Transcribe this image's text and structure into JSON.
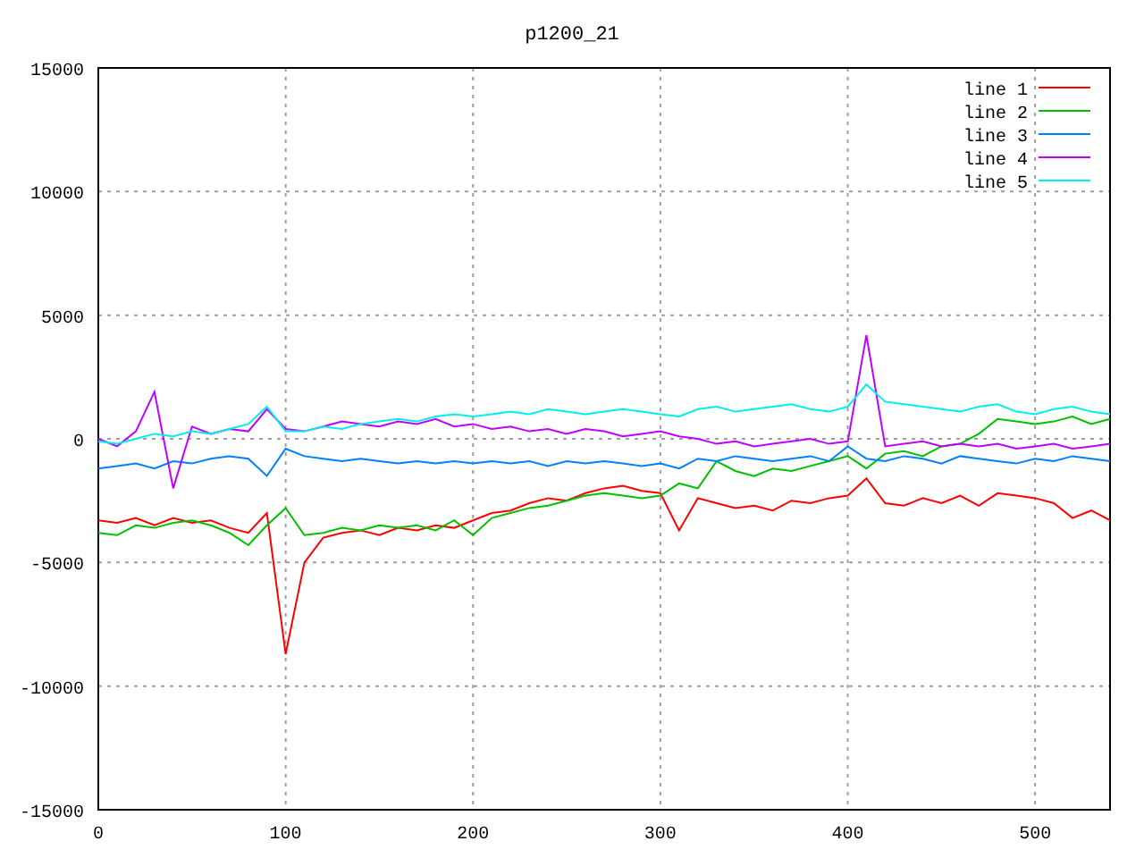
{
  "chart_data": {
    "type": "line",
    "title": "p1200_21",
    "x": [
      0,
      10,
      20,
      30,
      40,
      50,
      60,
      70,
      80,
      90,
      100,
      110,
      120,
      130,
      140,
      150,
      160,
      170,
      180,
      190,
      200,
      210,
      220,
      230,
      240,
      250,
      260,
      270,
      280,
      290,
      300,
      310,
      320,
      330,
      340,
      350,
      360,
      370,
      380,
      390,
      400,
      410,
      420,
      430,
      440,
      450,
      460,
      470,
      480,
      490,
      500,
      510,
      520,
      530,
      540
    ],
    "xlim": [
      0,
      540
    ],
    "ylim": [
      -15000,
      15000
    ],
    "xticks": [
      0,
      100,
      200,
      300,
      400,
      500
    ],
    "yticks": [
      -15000,
      -10000,
      -5000,
      0,
      5000,
      10000,
      15000
    ],
    "grid": true,
    "legend": true,
    "series": [
      {
        "name": "line 1",
        "color": "#ff0000",
        "values": [
          -3300,
          -3400,
          -3200,
          -3500,
          -3200,
          -3400,
          -3300,
          -3600,
          -3800,
          -3000,
          -8700,
          -5000,
          -4000,
          -3800,
          -3700,
          -3900,
          -3600,
          -3700,
          -3500,
          -3600,
          -3300,
          -3000,
          -2900,
          -2600,
          -2400,
          -2500,
          -2200,
          -2000,
          -1900,
          -2100,
          -2200,
          -3700,
          -2400,
          -2600,
          -2800,
          -2700,
          -2900,
          -2500,
          -2600,
          -2400,
          -2300,
          -1600,
          -2600,
          -2700,
          -2400,
          -2600,
          -2300,
          -2700,
          -2200,
          -2300,
          -2400,
          -2600,
          -3200,
          -2900,
          -3300
        ]
      },
      {
        "name": "line 2",
        "color": "#00c000",
        "values": [
          -3800,
          -3900,
          -3500,
          -3600,
          -3400,
          -3300,
          -3500,
          -3800,
          -4300,
          -3500,
          -2800,
          -3900,
          -3800,
          -3600,
          -3700,
          -3500,
          -3600,
          -3500,
          -3700,
          -3300,
          -3900,
          -3200,
          -3000,
          -2800,
          -2700,
          -2500,
          -2300,
          -2200,
          -2300,
          -2400,
          -2300,
          -1800,
          -2000,
          -900,
          -1300,
          -1500,
          -1200,
          -1300,
          -1100,
          -900,
          -700,
          -1200,
          -600,
          -500,
          -700,
          -300,
          -200,
          200,
          800,
          700,
          600,
          700,
          900,
          600,
          800
        ]
      },
      {
        "name": "line 3",
        "color": "#0080ff",
        "values": [
          -1200,
          -1100,
          -1000,
          -1200,
          -900,
          -1000,
          -800,
          -700,
          -800,
          -1500,
          -400,
          -700,
          -800,
          -900,
          -800,
          -900,
          -1000,
          -900,
          -1000,
          -900,
          -1000,
          -900,
          -1000,
          -900,
          -1100,
          -900,
          -1000,
          -900,
          -1000,
          -1100,
          -1000,
          -1200,
          -800,
          -900,
          -700,
          -800,
          -900,
          -800,
          -700,
          -900,
          -300,
          -800,
          -900,
          -700,
          -800,
          -1000,
          -700,
          -800,
          -900,
          -1000,
          -800,
          -900,
          -700,
          -800,
          -900
        ]
      },
      {
        "name": "line 4",
        "color": "#c000ff",
        "values": [
          0,
          -300,
          300,
          1900,
          -2000,
          500,
          200,
          400,
          300,
          1200,
          400,
          300,
          500,
          700,
          600,
          500,
          700,
          600,
          800,
          500,
          600,
          400,
          500,
          300,
          400,
          200,
          400,
          300,
          100,
          200,
          300,
          100,
          0,
          -200,
          -100,
          -300,
          -200,
          -100,
          0,
          -200,
          -100,
          4200,
          -300,
          -200,
          -100,
          -300,
          -200,
          -300,
          -200,
          -400,
          -300,
          -200,
          -400,
          -300,
          -200
        ]
      },
      {
        "name": "line 5",
        "color": "#00eeee",
        "values": [
          -100,
          -200,
          0,
          200,
          100,
          300,
          200,
          400,
          600,
          1300,
          300,
          300,
          500,
          400,
          600,
          700,
          800,
          700,
          900,
          1000,
          900,
          1000,
          1100,
          1000,
          1200,
          1100,
          1000,
          1100,
          1200,
          1100,
          1000,
          900,
          1200,
          1300,
          1100,
          1200,
          1300,
          1400,
          1200,
          1100,
          1300,
          2200,
          1500,
          1400,
          1300,
          1200,
          1100,
          1300,
          1400,
          1100,
          1000,
          1200,
          1300,
          1100,
          1000
        ]
      }
    ]
  }
}
